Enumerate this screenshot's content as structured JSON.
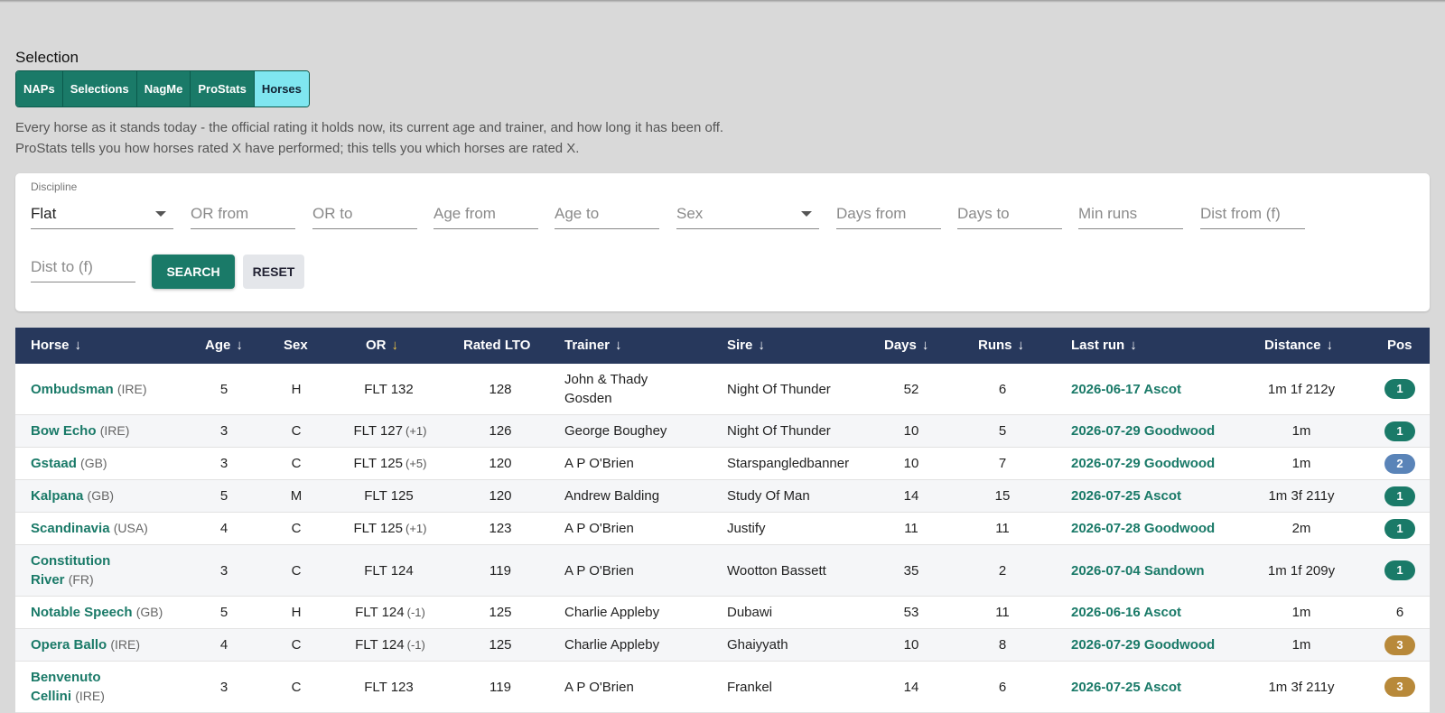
{
  "selection": {
    "title": "Selection",
    "tabs": [
      {
        "label": "NAPs",
        "active": false
      },
      {
        "label": "Selections",
        "active": false
      },
      {
        "label": "NagMe",
        "active": false
      },
      {
        "label": "ProStats",
        "active": false
      },
      {
        "label": "Horses",
        "active": true
      }
    ],
    "description": [
      "Every horse as it stands today - the official rating it holds now, its current age and trainer, and how long it has been off.",
      "ProStats tells you how horses rated X have performed; this tells you which horses are rated X."
    ]
  },
  "filters": {
    "discipline_label": "Discipline",
    "discipline_value": "Flat",
    "or_from": "OR from",
    "or_to": "OR to",
    "age_from": "Age from",
    "age_to": "Age to",
    "sex": "Sex",
    "days_from": "Days from",
    "days_to": "Days to",
    "min_runs": "Min runs",
    "dist_from": "Dist from (f)",
    "dist_to": "Dist to (f)",
    "search_label": "SEARCH",
    "reset_label": "RESET"
  },
  "table": {
    "headers": {
      "horse": "Horse",
      "age": "Age",
      "sex": "Sex",
      "or": "OR",
      "rated_lto": "Rated LTO",
      "trainer": "Trainer",
      "sire": "Sire",
      "days": "Days",
      "runs": "Runs",
      "last_run": "Last run",
      "distance": "Distance",
      "pos": "Pos"
    },
    "sort_arrow": "↓",
    "colors": {
      "header_bg": "#27385c",
      "link": "#1a7a68",
      "sort_active": "#f2c744"
    },
    "rows": [
      {
        "horse": "Ombudsman",
        "country": "(IRE)",
        "age": "5",
        "sex": "H",
        "or": "FLT 132",
        "or_adj": "",
        "rated_lto": "128",
        "trainer": "John & Thady Gosden",
        "sire": "Night Of Thunder",
        "days": "52",
        "runs": "6",
        "last_run": "2026-06-17 Ascot",
        "distance": "1m 1f 212y",
        "pos": "1",
        "pos_style": "p1"
      },
      {
        "horse": "Bow Echo",
        "country": "(IRE)",
        "age": "3",
        "sex": "C",
        "or": "FLT 127",
        "or_adj": "(+1)",
        "rated_lto": "126",
        "trainer": "George Boughey",
        "sire": "Night Of Thunder",
        "days": "10",
        "runs": "5",
        "last_run": "2026-07-29 Goodwood",
        "distance": "1m",
        "pos": "1",
        "pos_style": "p1"
      },
      {
        "horse": "Gstaad",
        "country": "(GB)",
        "age": "3",
        "sex": "C",
        "or": "FLT 125",
        "or_adj": "(+5)",
        "rated_lto": "120",
        "trainer": "A P O'Brien",
        "sire": "Starspangledbanner",
        "days": "10",
        "runs": "7",
        "last_run": "2026-07-29 Goodwood",
        "distance": "1m",
        "pos": "2",
        "pos_style": "p2"
      },
      {
        "horse": "Kalpana",
        "country": "(GB)",
        "age": "5",
        "sex": "M",
        "or": "FLT 125",
        "or_adj": "",
        "rated_lto": "120",
        "trainer": "Andrew Balding",
        "sire": "Study Of Man",
        "days": "14",
        "runs": "15",
        "last_run": "2026-07-25 Ascot",
        "distance": "1m 3f 211y",
        "pos": "1",
        "pos_style": "p1"
      },
      {
        "horse": "Scandinavia",
        "country": "(USA)",
        "age": "4",
        "sex": "C",
        "or": "FLT 125",
        "or_adj": "(+1)",
        "rated_lto": "123",
        "trainer": "A P O'Brien",
        "sire": "Justify",
        "days": "11",
        "runs": "11",
        "last_run": "2026-07-28 Goodwood",
        "distance": "2m",
        "pos": "1",
        "pos_style": "p1"
      },
      {
        "horse": "Constitution River",
        "country": "(FR)",
        "age": "3",
        "sex": "C",
        "or": "FLT 124",
        "or_adj": "",
        "rated_lto": "119",
        "trainer": "A P O'Brien",
        "sire": "Wootton Bassett",
        "days": "35",
        "runs": "2",
        "last_run": "2026-07-04 Sandown",
        "distance": "1m 1f 209y",
        "pos": "1",
        "pos_style": "p1"
      },
      {
        "horse": "Notable Speech",
        "country": "(GB)",
        "age": "5",
        "sex": "H",
        "or": "FLT 124",
        "or_adj": "(-1)",
        "rated_lto": "125",
        "trainer": "Charlie Appleby",
        "sire": "Dubawi",
        "days": "53",
        "runs": "11",
        "last_run": "2026-06-16 Ascot",
        "distance": "1m",
        "pos": "6",
        "pos_style": "plain"
      },
      {
        "horse": "Opera Ballo",
        "country": "(IRE)",
        "age": "4",
        "sex": "C",
        "or": "FLT 124",
        "or_adj": "(-1)",
        "rated_lto": "125",
        "trainer": "Charlie Appleby",
        "sire": "Ghaiyyath",
        "days": "10",
        "runs": "8",
        "last_run": "2026-07-29 Goodwood",
        "distance": "1m",
        "pos": "3",
        "pos_style": "p3"
      },
      {
        "horse": "Benvenuto Cellini",
        "country": "(IRE)",
        "age": "3",
        "sex": "C",
        "or": "FLT 123",
        "or_adj": "",
        "rated_lto": "119",
        "trainer": "A P O'Brien",
        "sire": "Frankel",
        "days": "14",
        "runs": "6",
        "last_run": "2026-07-25 Ascot",
        "distance": "1m 3f 211y",
        "pos": "3",
        "pos_style": "p3"
      }
    ]
  }
}
